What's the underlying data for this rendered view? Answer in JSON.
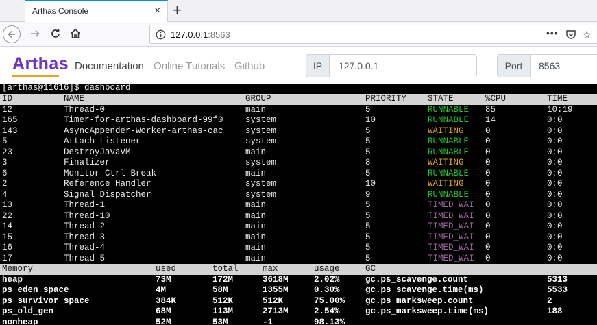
{
  "browser": {
    "tab_title": "Arthas Console",
    "tab_close": "×",
    "new_tab": "+",
    "url_host": "127.0.0.1",
    "url_port": ":8563",
    "url_more": "•••",
    "url_star": "☆"
  },
  "app": {
    "brand": "Arthas",
    "nav": [
      "Documentation",
      "Online Tutorials",
      "Github"
    ],
    "ip_label": "IP",
    "ip_value": "127.0.0.1",
    "port_label": "Port",
    "port_value": "8563"
  },
  "terminal": {
    "prompt": "[arthas@11616]$ dashboard",
    "thread_headers": [
      "ID",
      "NAME",
      "GROUP",
      "PRIORITY",
      "STATE",
      "%CPU",
      "TIME"
    ],
    "threads": [
      {
        "id": "12",
        "name": "Thread-0",
        "group": "main",
        "priority": "5",
        "state": "RUNNABLE",
        "cpu": "85",
        "time": "10:19"
      },
      {
        "id": "165",
        "name": "Timer-for-arthas-dashboard-99f0",
        "group": "system",
        "priority": "10",
        "state": "RUNNABLE",
        "cpu": "14",
        "time": "0:0"
      },
      {
        "id": "143",
        "name": "AsyncAppender-Worker-arthas-cac",
        "group": "system",
        "priority": "5",
        "state": "WAITING",
        "cpu": "0",
        "time": "0:0"
      },
      {
        "id": "5",
        "name": "Attach Listener",
        "group": "system",
        "priority": "5",
        "state": "RUNNABLE",
        "cpu": "0",
        "time": "0:0"
      },
      {
        "id": "23",
        "name": "DestroyJavaVM",
        "group": "main",
        "priority": "5",
        "state": "RUNNABLE",
        "cpu": "0",
        "time": "0:0"
      },
      {
        "id": "3",
        "name": "Finalizer",
        "group": "system",
        "priority": "8",
        "state": "WAITING",
        "cpu": "0",
        "time": "0:0"
      },
      {
        "id": "6",
        "name": "Monitor Ctrl-Break",
        "group": "main",
        "priority": "5",
        "state": "RUNNABLE",
        "cpu": "0",
        "time": "0:0"
      },
      {
        "id": "2",
        "name": "Reference Handler",
        "group": "system",
        "priority": "10",
        "state": "WAITING",
        "cpu": "0",
        "time": "0:0"
      },
      {
        "id": "4",
        "name": "Signal Dispatcher",
        "group": "system",
        "priority": "9",
        "state": "RUNNABLE",
        "cpu": "0",
        "time": "0:0"
      },
      {
        "id": "13",
        "name": "Thread-1",
        "group": "main",
        "priority": "5",
        "state": "TIMED_WAI",
        "cpu": "0",
        "time": "0:0"
      },
      {
        "id": "22",
        "name": "Thread-10",
        "group": "main",
        "priority": "5",
        "state": "TIMED_WAI",
        "cpu": "0",
        "time": "0:0"
      },
      {
        "id": "14",
        "name": "Thread-2",
        "group": "main",
        "priority": "5",
        "state": "TIMED_WAI",
        "cpu": "0",
        "time": "0:0"
      },
      {
        "id": "15",
        "name": "Thread-3",
        "group": "main",
        "priority": "5",
        "state": "TIMED_WAI",
        "cpu": "0",
        "time": "0:0"
      },
      {
        "id": "16",
        "name": "Thread-4",
        "group": "main",
        "priority": "5",
        "state": "TIMED_WAI",
        "cpu": "0",
        "time": "0:0"
      },
      {
        "id": "17",
        "name": "Thread-5",
        "group": "main",
        "priority": "5",
        "state": "TIMED_WAI",
        "cpu": "0",
        "time": "0:0"
      }
    ],
    "memory_headers": [
      "Memory",
      "used",
      "total",
      "max",
      "usage",
      "GC"
    ],
    "memory": [
      {
        "name": "heap",
        "used": "73M",
        "total": "172M",
        "max": "3618M",
        "usage": "2.02%",
        "gc": "gc.ps_scavenge.count",
        "gcval": "5313"
      },
      {
        "name": "ps_eden_space",
        "used": "4M",
        "total": "58M",
        "max": "1355M",
        "usage": "0.30%",
        "gc": "gc.ps_scavenge.time(ms)",
        "gcval": "5533"
      },
      {
        "name": "ps_survivor_space",
        "used": "384K",
        "total": "512K",
        "max": "512K",
        "usage": "75.00%",
        "gc": "gc.ps_marksweep.count",
        "gcval": "2"
      },
      {
        "name": "ps_old_gen",
        "used": "68M",
        "total": "113M",
        "max": "2713M",
        "usage": "2.54%",
        "gc": "gc.ps_marksweep.time(ms)",
        "gcval": "188"
      },
      {
        "name": "nonheap",
        "used": "52M",
        "total": "53M",
        "max": "-1",
        "usage": "98.13%",
        "gc": "",
        "gcval": ""
      }
    ]
  },
  "colors": {
    "runnable": "#1fbf2c",
    "waiting": "#d9a400",
    "timed_waiting": "#a36aa3",
    "brand": "#6c35c4"
  }
}
